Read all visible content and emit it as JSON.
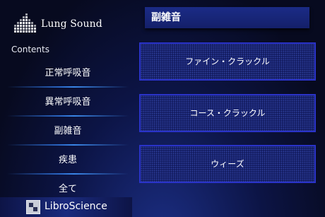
{
  "app": {
    "logo_text": "Lung Sound"
  },
  "sidebar": {
    "contents_label": "Contents",
    "items": [
      {
        "label": "正常呼吸音"
      },
      {
        "label": "異常呼吸音"
      },
      {
        "label": "副雑音"
      },
      {
        "label": "疾患"
      },
      {
        "label": "全て"
      }
    ],
    "footer_brand": "LibroScience"
  },
  "main": {
    "title": "副雑音",
    "cards": [
      {
        "label": "ファイン・クラックル"
      },
      {
        "label": "コース・クラックル"
      },
      {
        "label": "ウィーズ"
      }
    ]
  },
  "colors": {
    "background": "#080b22",
    "card_border": "#2a33c9",
    "title_bar": "#1b2b86",
    "separator": "#3a86e8"
  }
}
